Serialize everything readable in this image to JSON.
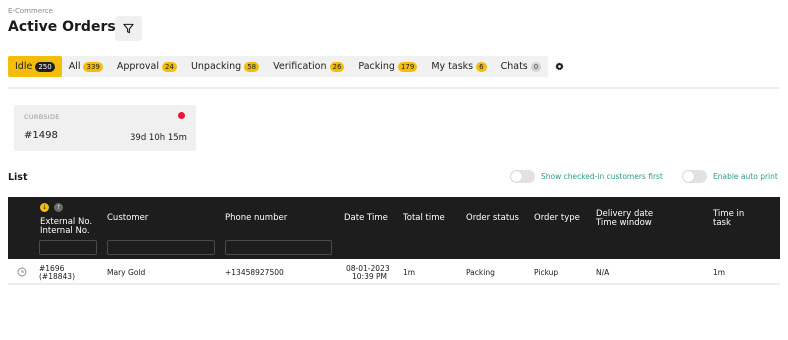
{
  "header": {
    "breadcrumb": "E-Commerce",
    "title": "Active Orders",
    "filter_icon": "filter-icon"
  },
  "tabs": [
    {
      "label": "Idle",
      "count": "250",
      "active": true
    },
    {
      "label": "All",
      "count": "339"
    },
    {
      "label": "Approval",
      "count": "24"
    },
    {
      "label": "Unpacking",
      "count": "58"
    },
    {
      "label": "Verification",
      "count": "26"
    },
    {
      "label": "Packing",
      "count": "179"
    },
    {
      "label": "My tasks",
      "count": "6"
    },
    {
      "label": "Chats",
      "count": "0"
    }
  ],
  "settings_icon": "gear-icon",
  "curbside_card": {
    "label": "CURBSIDE",
    "order": "#1498",
    "elapsed": "39d 10h 15m",
    "status_color": "#e8173a"
  },
  "list": {
    "title": "List",
    "toggle_checked_in": "Show checked-in customers first",
    "toggle_auto_print": "Enable auto print"
  },
  "table": {
    "columns": {
      "external_no": "External No.",
      "internal_no": "Internal No.",
      "customer": "Customer",
      "phone": "Phone number",
      "date_time": "Date Time",
      "total_time": "Total time",
      "order_status": "Order status",
      "order_type": "Order type",
      "delivery_date": "Delivery date",
      "time_window": "Time window",
      "time_in": "Time in",
      "task": "task"
    },
    "rows": [
      {
        "external_no": "#1696",
        "internal_no": "(#18843)",
        "customer": "Mary Gold",
        "phone": "+13458927500",
        "date": "08-01-2023",
        "time": "10:39 PM",
        "total_time": "1m",
        "order_status": "Packing",
        "order_type": "Pickup",
        "delivery": "N/A",
        "time_in_task": "1m"
      }
    ]
  },
  "colors": {
    "accent": "#f5bd0b",
    "header_bg": "#1d1d1d",
    "toggle_label": "#2e9c8a",
    "alert_dot": "#e8173a"
  }
}
